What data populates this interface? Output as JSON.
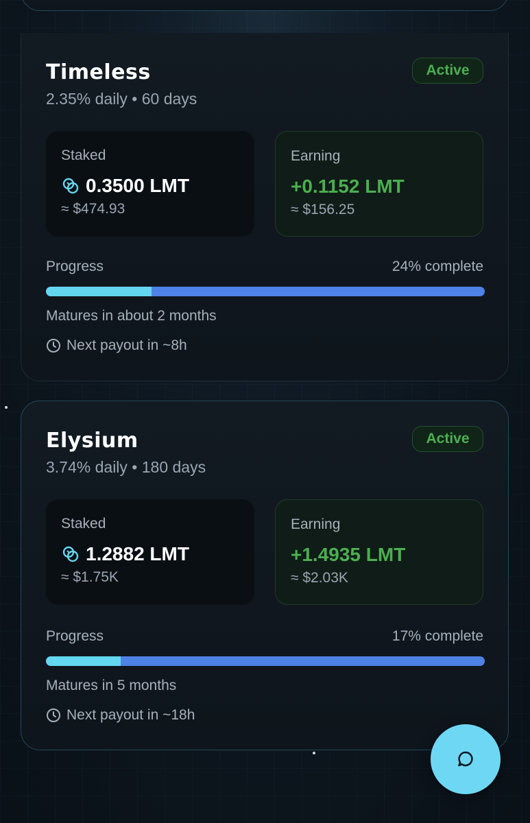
{
  "cards": [
    {
      "title": "Timeless",
      "subtitle": "2.35% daily • 60 days",
      "status": "Active",
      "staked_label": "Staked",
      "staked_value": "0.3500 LMT",
      "staked_usd": "≈ $474.93",
      "earning_label": "Earning",
      "earning_value": "+0.1152 LMT",
      "earning_usd": "≈ $156.25",
      "progress_label": "Progress",
      "progress_pct_text": "24% complete",
      "progress": 0.24,
      "matures": "Matures in about 2 months",
      "payout": "Next payout in ~8h"
    },
    {
      "title": "Elysium",
      "subtitle": "3.74% daily • 180 days",
      "status": "Active",
      "staked_label": "Staked",
      "staked_value": "1.2882 LMT",
      "staked_usd": "≈ $1.75K",
      "earning_label": "Earning",
      "earning_value": "+1.4935 LMT",
      "earning_usd": "≈ $2.03K",
      "progress_label": "Progress",
      "progress_pct_text": "17% complete",
      "progress": 0.17,
      "matures": "Matures in 5 months",
      "payout": "Next payout in ~18h"
    }
  ],
  "colors": {
    "accent_cyan": "#64d7f0",
    "accent_blue": "#4f82e6",
    "active_green": "#4caf50"
  },
  "icons": {
    "coin": "coins-icon",
    "clock": "clock-icon",
    "chat": "chat-bubble-icon"
  }
}
